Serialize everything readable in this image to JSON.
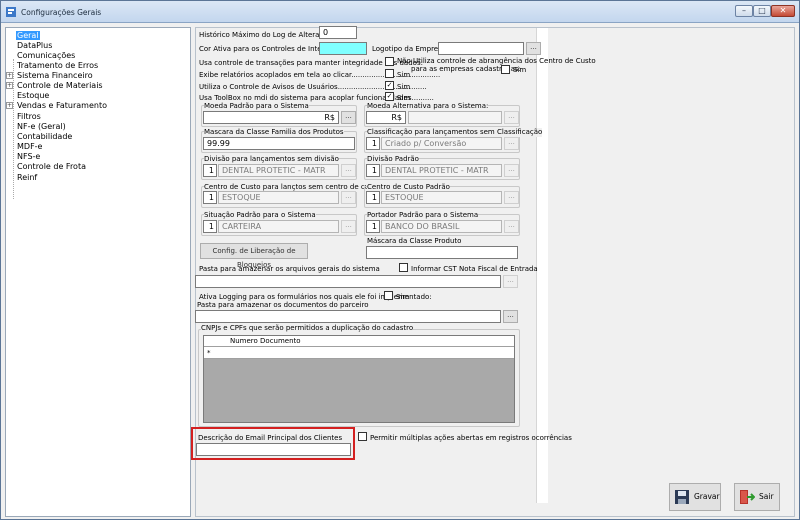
{
  "window": {
    "title": "Configurações Gerais",
    "minimize": "–",
    "maximize": "□",
    "close": "✕"
  },
  "tree": {
    "items": [
      {
        "label": "Geral",
        "selected": true,
        "expander": ""
      },
      {
        "label": "DataPlus",
        "expander": ""
      },
      {
        "label": "Comunicações",
        "expander": ""
      },
      {
        "label": "Tratamento de Erros",
        "expander": ""
      },
      {
        "label": "Sistema Financeiro",
        "expander": "+"
      },
      {
        "label": "Controle de Materiais",
        "expander": "+"
      },
      {
        "label": "Estoque",
        "expander": ""
      },
      {
        "label": "Vendas e Faturamento",
        "expander": "+"
      },
      {
        "label": "Filtros",
        "expander": ""
      },
      {
        "label": "NF-e (Geral)",
        "expander": ""
      },
      {
        "label": "Contabilidade",
        "expander": ""
      },
      {
        "label": "MDF-e",
        "expander": ""
      },
      {
        "label": "NFS-e",
        "expander": ""
      },
      {
        "label": "Controle de Frota",
        "expander": ""
      },
      {
        "label": "Reinf",
        "expander": ""
      }
    ]
  },
  "form": {
    "historico_label": "Histórico Máximo do Log de Alterações:",
    "historico_value": "0",
    "cor_label": "Cor Ativa para os Controles de Interface",
    "logotipo_label": "Logotipo da Empresa:",
    "transacoes_label": "Usa controle de transações para manter integridade dos dados:",
    "nao_utiliza_label": "Não Utiliza controle de abrangência dos Centro de Custo",
    "para_empresas_label": "para as empresas cadastradas:",
    "sim": "Sim",
    "exibe_label": "Exibe relatórios acoplados em tela ao clicar........................................",
    "avisos_label": "Utiliza o Controle de Avisos de Usuários........................................",
    "toolbox_label": "Usa ToolBox no mdi do sistema para acoplar funcionalidades..........",
    "check_mark": "✓",
    "moeda_label": "Moeda Padrão para o Sistema",
    "moeda_value": "R$",
    "moeda_alt_label": "Moeda Alternativa para o Sistema:",
    "moeda_alt_value": "R$",
    "mascara_label": "Mascara da Classe Familia dos Produtos",
    "mascara_value": "99.99",
    "classificacao_label": "Classificação para lançamentos sem Classificação",
    "classificacao_num": "1",
    "classificacao_value": "Criado p/ Conversão",
    "divisao_lanc_label": "Divisão para lançamentos sem divisão",
    "divisao_lanc_num": "1",
    "divisao_lanc_value": "DENTAL PROTETIC - MATR",
    "divisao_padrao_label": "Divisão Padrão",
    "divisao_padrao_num": "1",
    "divisao_padrao_value": "DENTAL PROTETIC - MATR",
    "centro_lanc_label": "Centro de Custo para lançtos sem centro de custo",
    "centro_lanc_num": "1",
    "centro_lanc_value": "ESTOQUE",
    "centro_padrao_label": "Centro de Custo Padrão",
    "centro_padrao_num": "1",
    "centro_padrao_value": "ESTOQUE",
    "situacao_label": "Situação Padrão para o Sistema",
    "situacao_num": "1",
    "situacao_value": "CARTEIRA",
    "portador_label": "Portador Padrão para o Sistema",
    "portador_num": "1",
    "portador_value": "BANCO DO BRASIL",
    "config_button": "Config. de Liberação de Bloqueios",
    "mascara_produto_label": "Máscara da Classe Produto",
    "pasta_arquivos_label": "Pasta para amazenar os arquivos gerais do sistema",
    "informar_cst_label": "Informar CST Nota Fiscal de Entrada",
    "ativa_logging_label": "Ativa Logging para os formulários nos quais ele foi implementado:",
    "pasta_parceiro_label": "Pasta para amazenar os documentos do parceiro",
    "cnpj_group_label": "CNPJs e CPFs que serão permitidos a duplicação do cadastro",
    "grid_header": "Numero Documento",
    "grid_row_marker": "*",
    "email_label": "Descrição do Email Principal dos Clientes",
    "multiplas_label": "Permitir múltiplas ações abertas em registros ocorrências",
    "ellipsis": "..."
  },
  "buttons": {
    "gravar": "Gravar",
    "sair": "Sair"
  },
  "colors": {
    "accent_field": "#7fffff",
    "selected": "#3399ff",
    "highlight_box": "#d32020"
  }
}
